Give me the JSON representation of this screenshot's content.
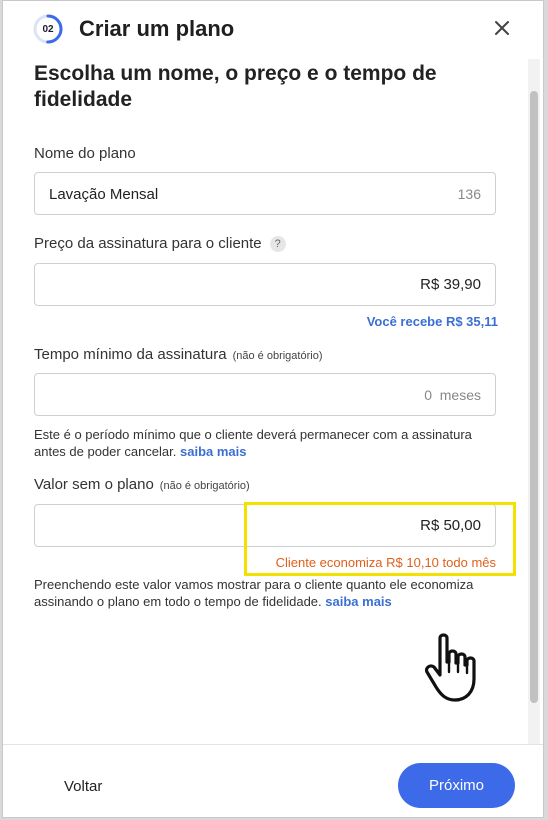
{
  "header": {
    "step": "02",
    "title": "Criar um plano",
    "step_progress": 0.5
  },
  "main": {
    "heading": "Escolha um nome, o preço e o tempo de fidelidade",
    "plan_name": {
      "label": "Nome do plano",
      "value": "Lavação Mensal",
      "counter": "136"
    },
    "price": {
      "label": "Preço da assinatura para o cliente",
      "help": "?",
      "value": "R$ 39,90",
      "note": "Você recebe R$ 35,11"
    },
    "min_time": {
      "label": "Tempo mínimo da assinatura",
      "optional": "(não é obrigatório)",
      "placeholder": "0  meses",
      "desc": "Este é o período mínimo que o cliente deverá permanecer com a assinatura antes de poder cancelar.",
      "link": "saiba mais"
    },
    "value_without": {
      "label": "Valor sem o plano",
      "optional": "(não é obrigatório)",
      "value": "R$ 50,00",
      "savings": "Cliente economiza R$ 10,10 todo mês",
      "desc": "Preenchendo este valor vamos mostrar para o cliente quanto ele economiza assinando o plano em todo o tempo de fidelidade.",
      "link": "saiba mais"
    }
  },
  "footer": {
    "back_label": "Voltar",
    "next_label": "Próximo"
  },
  "colors": {
    "accent": "#3d6ae8",
    "link": "#3b6fd4",
    "savings": "#e0601a",
    "highlight": "#f3e200"
  }
}
